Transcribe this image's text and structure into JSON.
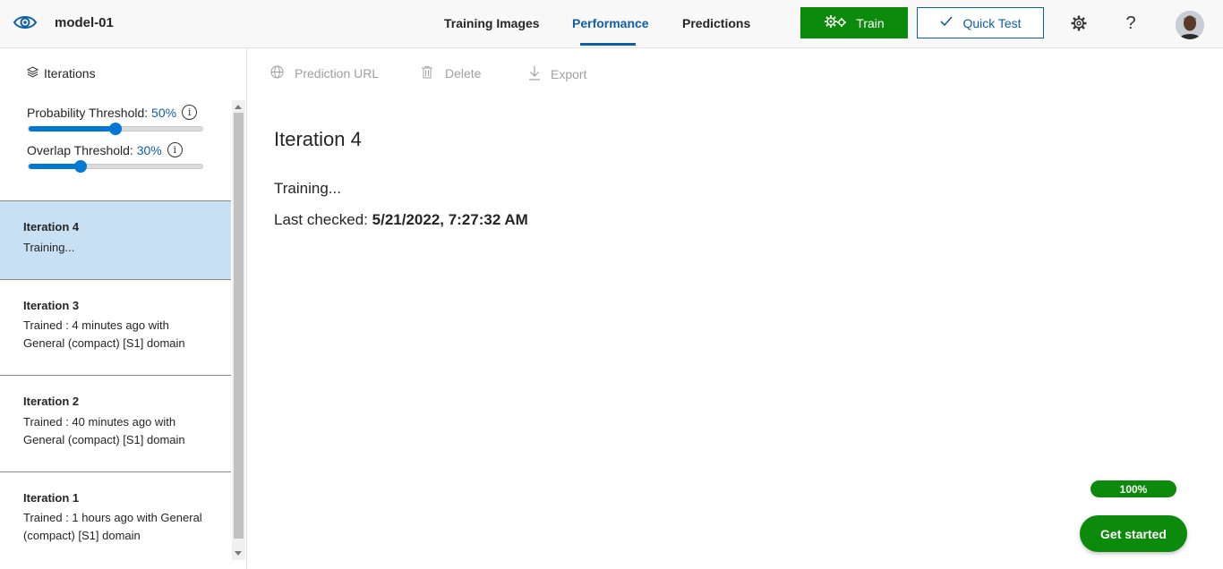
{
  "header": {
    "project_name": "model-01",
    "tabs": [
      {
        "label": "Training Images",
        "active": false
      },
      {
        "label": "Performance",
        "active": true
      },
      {
        "label": "Predictions",
        "active": false
      }
    ],
    "train_label": "Train",
    "quick_test_label": "Quick Test",
    "help_label": "?"
  },
  "sidebar": {
    "iterations_heading": "Iterations",
    "probability": {
      "label": "Probability Threshold:",
      "value": "50%",
      "level": 0.5
    },
    "overlap": {
      "label": "Overlap Threshold:",
      "value": "30%",
      "level": 0.3
    },
    "info_glyph": "i",
    "items": [
      {
        "title": "Iteration 4",
        "status": "Training...",
        "selected": true
      },
      {
        "title": "Iteration 3",
        "status": "Trained : 4 minutes ago with General (compact) [S1] domain",
        "selected": false
      },
      {
        "title": "Iteration 2",
        "status": "Trained : 40 minutes ago with General (compact) [S1] domain",
        "selected": false
      },
      {
        "title": "Iteration 1",
        "status": "Trained : 1 hours ago with General (compact) [S1] domain",
        "selected": false
      }
    ]
  },
  "toolbar": {
    "prediction_url_label": "Prediction URL",
    "delete_label": "Delete",
    "export_label": "Export"
  },
  "main": {
    "title": "Iteration 4",
    "status": "Training...",
    "last_checked_label": "Last checked:",
    "last_checked_value": "5/21/2022, 7:27:32 AM"
  },
  "progress": {
    "label": "100%",
    "level": 1.0
  },
  "get_started_label": "Get started",
  "colors": {
    "accent": "#0f5fa6",
    "primary_green": "#0c8a0c",
    "selected_bg": "#c7e0f4",
    "slider_blue": "#0078d4"
  }
}
